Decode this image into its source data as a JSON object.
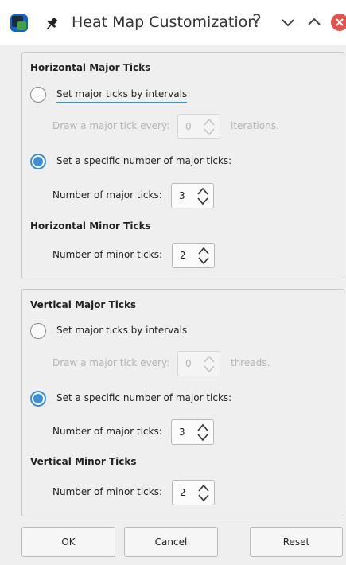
{
  "window": {
    "title": "Heat Map Customization",
    "help_label": "?"
  },
  "horizontal": {
    "major_heading": "Horizontal Major Ticks",
    "interval_option_label": "Set major ticks by intervals",
    "interval_option_selected": false,
    "interval_prefix": "Draw a major tick every:",
    "interval_value": "0",
    "interval_suffix": "iterations.",
    "count_option_label": "Set a specific number of major ticks:",
    "count_option_selected": true,
    "major_count_label": "Number of major ticks:",
    "major_count_value": "3",
    "minor_heading": "Horizontal Minor Ticks",
    "minor_count_label": "Number of minor ticks:",
    "minor_count_value": "2"
  },
  "vertical": {
    "major_heading": "Vertical Major Ticks",
    "interval_option_label": "Set major ticks by intervals",
    "interval_option_selected": false,
    "interval_prefix": "Draw a major tick every:",
    "interval_value": "0",
    "interval_suffix": "threads.",
    "count_option_label": "Set a specific number of major ticks:",
    "count_option_selected": true,
    "major_count_label": "Number of major ticks:",
    "major_count_value": "3",
    "minor_heading": "Vertical Minor Ticks",
    "minor_count_label": "Number of minor ticks:",
    "minor_count_value": "2"
  },
  "buttons": {
    "ok": "OK",
    "cancel": "Cancel",
    "reset": "Reset"
  },
  "colors": {
    "accent": "#3d8fd6",
    "close": "#e0544f"
  }
}
